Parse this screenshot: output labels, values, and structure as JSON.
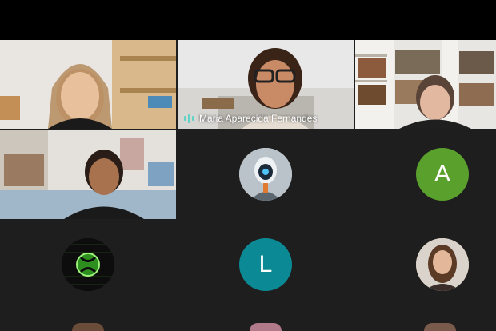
{
  "meeting": {
    "participants": [
      {
        "id": "p1",
        "name": "",
        "speaking": true
      },
      {
        "id": "p2",
        "name": "Maria Aparecida Fernandes",
        "speaking": false
      },
      {
        "id": "p3",
        "name": "",
        "speaking": false
      },
      {
        "id": "p4",
        "name": "",
        "speaking": false
      },
      {
        "id": "p5",
        "avatar": "robot-avatar",
        "name": ""
      },
      {
        "id": "p6",
        "avatar_letter": "A",
        "name": ""
      },
      {
        "id": "p7",
        "avatar": "xbox-avatar",
        "name": ""
      },
      {
        "id": "p8",
        "avatar_letter": "L",
        "name": ""
      },
      {
        "id": "p9",
        "avatar": "photo-avatar",
        "name": ""
      }
    ]
  },
  "colors": {
    "background": "#1e1e1e",
    "speaking_accent": "#5fd4c6",
    "avatar_a": "#5aa02c",
    "avatar_l": "#0b8a95"
  }
}
